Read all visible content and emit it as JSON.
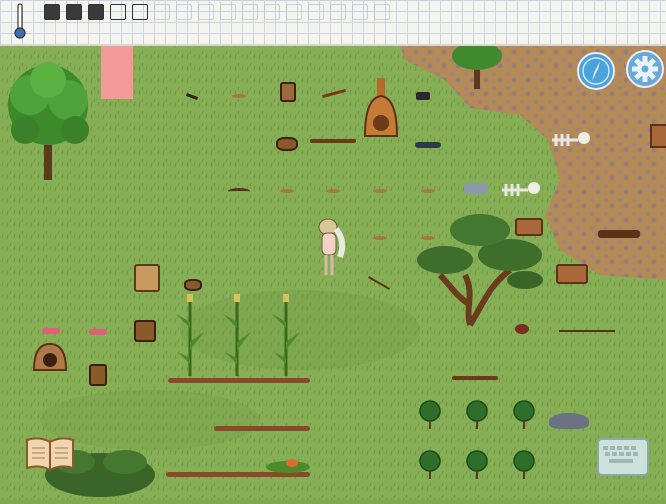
{
  "hud": {
    "temperature_icon": "thermometer-icon",
    "inventory_slots": [
      {
        "icon": "hat-slot-icon",
        "state": "filled"
      },
      {
        "icon": "shirt-slot-icon",
        "state": "filled"
      },
      {
        "icon": "backpack-slot-icon",
        "state": "filled"
      },
      {
        "icon": "empty-slot-icon",
        "state": "empty"
      },
      {
        "icon": "empty-slot-icon",
        "state": "empty"
      },
      {
        "icon": "empty-slot-icon",
        "state": "faded"
      },
      {
        "icon": "empty-slot-icon",
        "state": "faded"
      },
      {
        "icon": "empty-slot-icon",
        "state": "faded"
      },
      {
        "icon": "empty-slot-icon",
        "state": "faded"
      },
      {
        "icon": "empty-slot-icon",
        "state": "faded"
      },
      {
        "icon": "empty-slot-icon",
        "state": "faded"
      },
      {
        "icon": "empty-slot-icon",
        "state": "faded"
      },
      {
        "icon": "empty-slot-icon",
        "state": "faded"
      },
      {
        "icon": "empty-slot-icon",
        "state": "faded"
      },
      {
        "icon": "empty-slot-icon",
        "state": "faded"
      },
      {
        "icon": "empty-slot-icon",
        "state": "faded"
      }
    ]
  },
  "controls": {
    "compass_icon": "compass-icon",
    "settings_icon": "gear-icon",
    "recipe_book_icon": "book-icon",
    "keyboard_icon": "keyboard-icon"
  },
  "colors": {
    "grass": "#7fa94f",
    "dirt": "#b08656",
    "compass_bg": "#4aa3d9",
    "settings_bg": "#6aa8d6"
  }
}
